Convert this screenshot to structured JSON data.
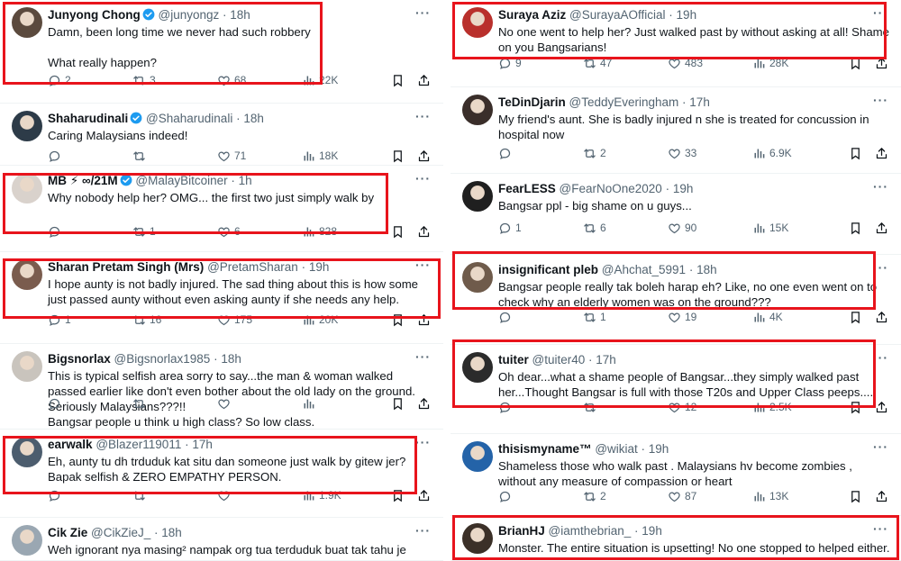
{
  "accent": "#1d9bf0",
  "highlight_color": "#e8141c",
  "icons": {
    "reply": "reply-icon",
    "retweet": "retweet-icon",
    "like": "heart-icon",
    "views": "views-icon",
    "bookmark": "bookmark-icon",
    "share": "share-icon",
    "more": "more-icon",
    "verified": "verified-badge-icon"
  },
  "left": [
    {
      "name": "Junyong Chong",
      "handle": "@junyongz",
      "time": "18h",
      "verified": true,
      "text": "Damn, been long time we never had such robbery\n\nWhat really happen?",
      "replies": "2",
      "retweets": "3",
      "likes": "68",
      "views": "22K"
    },
    {
      "name": "Shaharudinali",
      "handle": "@Shaharudinali",
      "time": "18h",
      "verified": true,
      "text": "Caring Malaysians indeed!",
      "replies": "",
      "retweets": "",
      "likes": "71",
      "views": "18K"
    },
    {
      "name": "MB ⚡ ∞/21M",
      "handle": "@MalayBitcoiner",
      "time": "1h",
      "verified": true,
      "text": "Why nobody help her? OMG... the first two just simply walk by",
      "replies": "",
      "retweets": "1",
      "likes": "6",
      "views": "828"
    },
    {
      "name": "Sharan Pretam Singh (Mrs)",
      "handle": "@PretamSharan",
      "time": "19h",
      "verified": false,
      "text": "I hope aunty is not badly injured. The sad thing about this is how some just passed aunty without even asking aunty if she needs any help.",
      "replies": "1",
      "retweets": "16",
      "likes": "175",
      "views": "20K"
    },
    {
      "name": "Bigsnorlax",
      "handle": "@Bigsnorlax1985",
      "time": "18h",
      "verified": false,
      "text": "This is typical selfish area sorry to say...the man & woman walked passed earlier like don't even bother about the old lady on the ground.\nSeriously Malaysians???!!\nBangsar people u think u high class? So low class.",
      "replies": "",
      "retweets": "",
      "likes": "",
      "views": ""
    },
    {
      "name": "earwalk",
      "handle": "@Blazer119011",
      "time": "17h",
      "verified": false,
      "text": "Eh, aunty tu dh trduduk kat situ dan someone just walk by gitew jer?\nBapak selfish & ZERO EMPATHY PERSON.",
      "replies": "",
      "retweets": "",
      "likes": "",
      "views": "1.9K"
    },
    {
      "name": "Cik Zie",
      "handle": "@CikZieJ_",
      "time": "18h",
      "verified": false,
      "text": "Weh ignorant nya masing² nampak org tua terduduk buat tak tahu je",
      "replies": "",
      "retweets": "",
      "likes": "",
      "views": ""
    }
  ],
  "right": [
    {
      "name": "Suraya Aziz",
      "handle": "@SurayaAOfficial",
      "time": "19h",
      "verified": false,
      "text": "No one went to help her? Just walked past by without asking at all! Shame on you Bangsarians!",
      "replies": "9",
      "retweets": "47",
      "likes": "483",
      "views": "28K"
    },
    {
      "name": "TeDinDjarin",
      "handle": "@TeddyEveringham",
      "time": "17h",
      "verified": false,
      "text": "My friend's aunt. She is badly injured n she is treated for concussion in hospital now",
      "replies": "",
      "retweets": "2",
      "likes": "33",
      "views": "6.9K"
    },
    {
      "name": "FearLESS",
      "handle": "@FearNoOne2020",
      "time": "19h",
      "verified": false,
      "text": "Bangsar ppl - big shame on u guys...",
      "replies": "1",
      "retweets": "6",
      "likes": "90",
      "views": "15K"
    },
    {
      "name": "insignificant pleb",
      "handle": "@Ahchat_5991",
      "time": "18h",
      "verified": false,
      "text": "Bangsar people really tak boleh harap eh? Like, no one even went on to check why an elderly women was on the ground???",
      "replies": "",
      "retweets": "1",
      "likes": "19",
      "views": "4K"
    },
    {
      "name": "tuiter",
      "handle": "@tuiter40",
      "time": "17h",
      "verified": false,
      "text": "Oh dear...what a shame people of Bangsar...they simply walked past her...Thought Bangsar is full with those T20s and Upper Class peeps....",
      "replies": "",
      "retweets": "",
      "likes": "12",
      "views": "2.5K"
    },
    {
      "name": "thisismyname™",
      "handle": "@wikiat",
      "time": "19h",
      "verified": false,
      "text": "Shameless those who walk past . Malaysians hv become zombies , without any measure of compassion or heart",
      "replies": "",
      "retweets": "2",
      "likes": "87",
      "views": "13K"
    },
    {
      "name": "BrianHJ",
      "handle": "@iamthebrian_",
      "time": "19h",
      "verified": false,
      "text": "Monster. The entire situation is upsetting! No one stopped to helped either.",
      "replies": "",
      "retweets": "",
      "likes": "",
      "views": ""
    }
  ]
}
